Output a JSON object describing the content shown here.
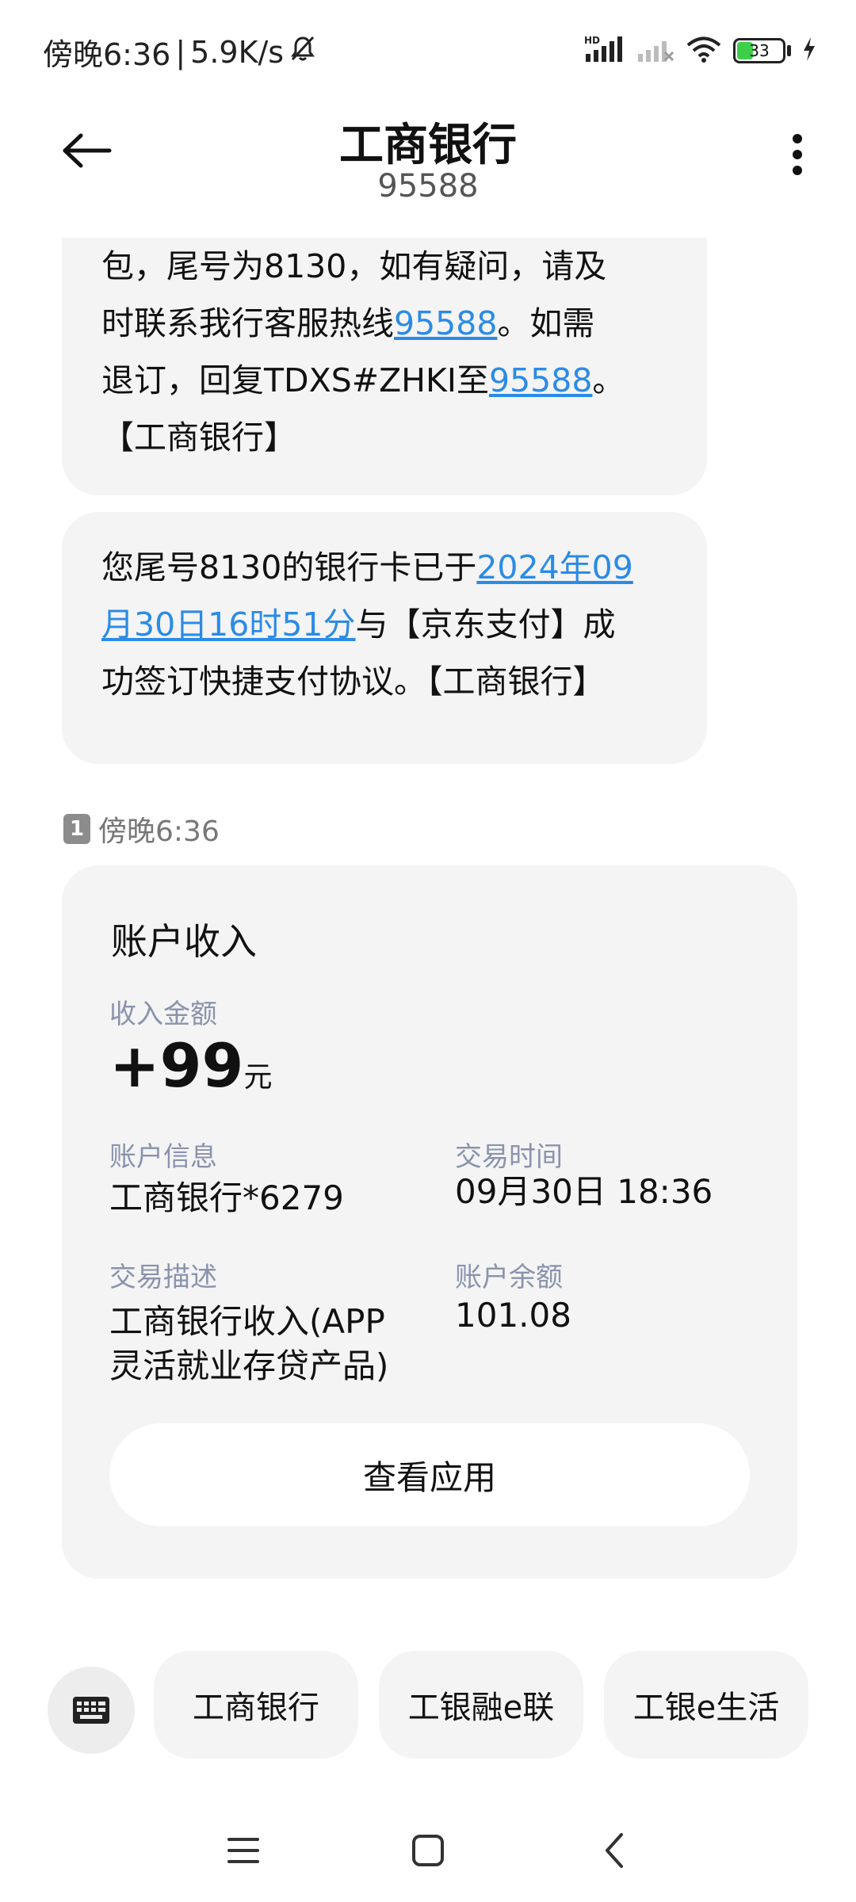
{
  "status_bar": {
    "time": "傍晚6:36",
    "separator": "|",
    "net_speed": "5.9K/s",
    "hd_label": "HD",
    "battery_level": "33",
    "battery_fraction": 0.33,
    "icons": [
      "bell-off-icon",
      "signal-icon",
      "signal-weak-icon",
      "wifi-icon",
      "battery-icon",
      "charging-icon"
    ]
  },
  "header": {
    "title": "工商银行",
    "number": "95588"
  },
  "messages": {
    "msg1": {
      "line1": "包，尾号为8130，如有疑问，请及",
      "line2_text": "时联系我行客服热线",
      "line2_link": "95588",
      "line2_tail": "。如需",
      "line3_text": "退订，回复TDXS#ZHKI至",
      "line3_link": "95588",
      "line3_tail": "。",
      "line4": "【工商银行】"
    },
    "msg2": {
      "line1_text": "您尾号8130的银行卡已于",
      "line1_link": "2024年09",
      "line2_link": "月30日16时51分",
      "line2_tail": "与【京东支付】成",
      "line3": "功签订快捷支付协议。【工商银行】"
    }
  },
  "timestamp": {
    "sim": "1",
    "time": "傍晚6:36"
  },
  "card": {
    "title": "账户收入",
    "amount_label": "收入金额",
    "amount": "+99",
    "amount_unit": "元",
    "account_label": "账户信息",
    "account_value": "工商银行*6279",
    "time_label": "交易时间",
    "time_value": "09月30日 18:36",
    "desc_label": "交易描述",
    "desc_line1": "工商银行收入(APP",
    "desc_line2": "灵活就业存贷产品)",
    "balance_label": "账户余额",
    "balance_value": "101.08",
    "button": "查看应用"
  },
  "menu": {
    "items": [
      "工商银行",
      "工银融e联",
      "工银e生活"
    ]
  },
  "colors": {
    "link": "#2b8be6",
    "bubble": "#f4f4f4",
    "label": "#8a93ad"
  }
}
